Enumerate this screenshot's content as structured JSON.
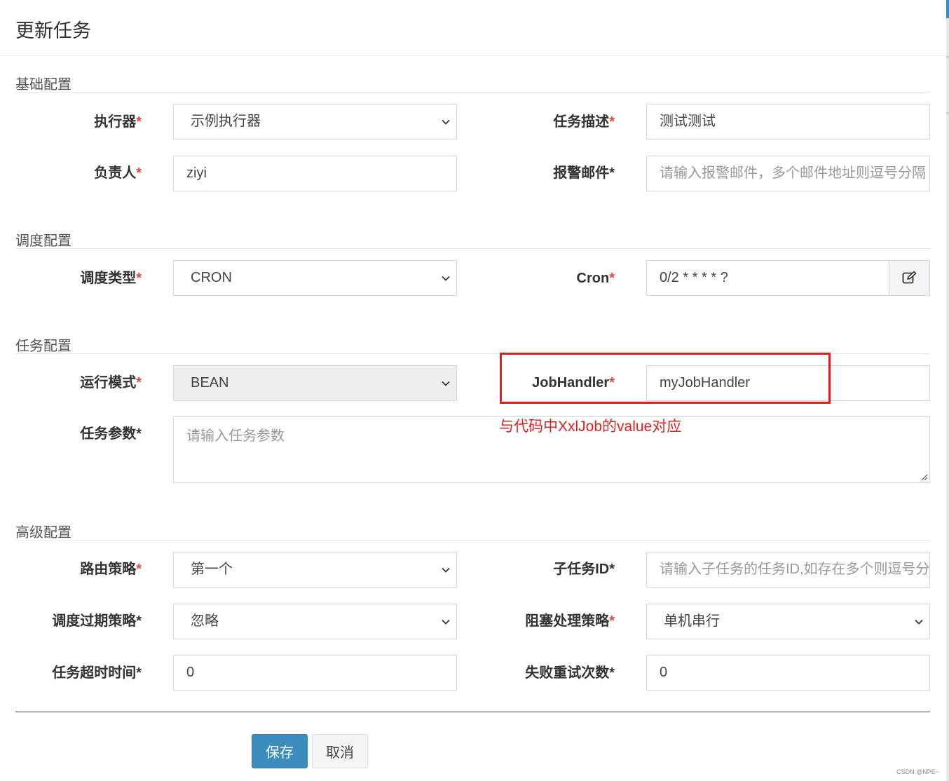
{
  "title": "更新任务",
  "sections": {
    "basic": "基础配置",
    "schedule": "调度配置",
    "task": "任务配置",
    "advanced": "高级配置"
  },
  "fields": {
    "executor": {
      "label": "执行器",
      "required_mark": "*",
      "value": "示例执行器"
    },
    "job_desc": {
      "label": "任务描述",
      "required_mark": "*",
      "value": "测试测试"
    },
    "author": {
      "label": "负责人",
      "required_mark": "*",
      "value": "ziyi"
    },
    "alarm_email": {
      "label": "报警邮件*",
      "placeholder": "请输入报警邮件，多个邮件地址则逗号分隔"
    },
    "schedule_type": {
      "label": "调度类型",
      "required_mark": "*",
      "value": "CRON"
    },
    "cron": {
      "label": "Cron",
      "required_mark": "*",
      "value": "0/2 * * * * ?"
    },
    "run_mode": {
      "label": "运行模式",
      "required_mark": "*",
      "value": "BEAN"
    },
    "job_handler": {
      "label": "JobHandler",
      "required_mark": "*",
      "value": "myJobHandler"
    },
    "job_param": {
      "label": "任务参数*",
      "placeholder": "请输入任务参数"
    },
    "route_strategy": {
      "label": "路由策略",
      "required_mark": "*",
      "value": "第一个"
    },
    "child_job_id": {
      "label": "子任务ID*",
      "placeholder": "请输入子任务的任务ID,如存在多个则逗号分隔"
    },
    "misfire_strategy": {
      "label": "调度过期策略*",
      "value": "忽略"
    },
    "block_strategy": {
      "label": "阻塞处理策略",
      "required_mark": "*",
      "value": "单机串行"
    },
    "timeout": {
      "label": "任务超时时间*",
      "value": "0"
    },
    "fail_retry": {
      "label": "失败重试次数*",
      "value": "0"
    }
  },
  "annotation": "与代码中XxlJob的value对应",
  "buttons": {
    "save": "保存",
    "cancel": "取消"
  },
  "watermark": "CSDN @NPE~",
  "colors": {
    "primary": "#3c8dbc",
    "required": "#dd4b39",
    "annotation": "#e02020"
  },
  "icons": {
    "cron_addon": "edit-icon",
    "select": "chevron-down-icon"
  }
}
